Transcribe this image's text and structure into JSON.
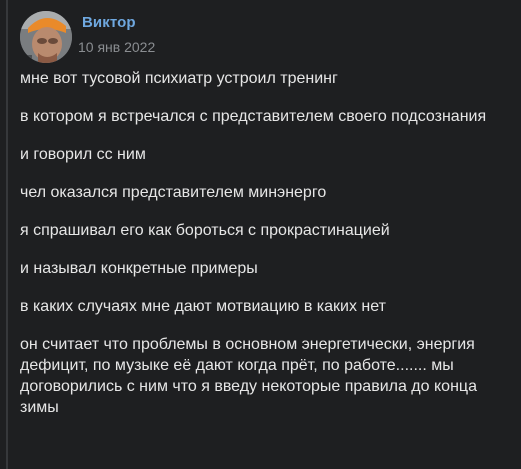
{
  "post": {
    "author": "Виктор",
    "date": "10 янв 2022",
    "messages": [
      "мне вот тусовой психиатр устроил тренинг",
      "в котором я встречался с представителем своего подсознания",
      "и говорил сс ним",
      "чел оказался представителем минэнерго",
      "я спрашивал его как бороться с прокрастинацией",
      "и называл конкретные примеры",
      "в каких случаях мне дают мотвиацию в каких нет",
      "он считает что проблемы в основном энергетически, энергия дефицит, по музыке её дают когда прёт, по работе....... мы договорились с ним что я введу некоторые правила до конца зимы"
    ]
  },
  "colors": {
    "background": "#1e1f21",
    "author": "#6fa8e0",
    "text": "#e6e6e6",
    "meta": "#8a8d91"
  }
}
